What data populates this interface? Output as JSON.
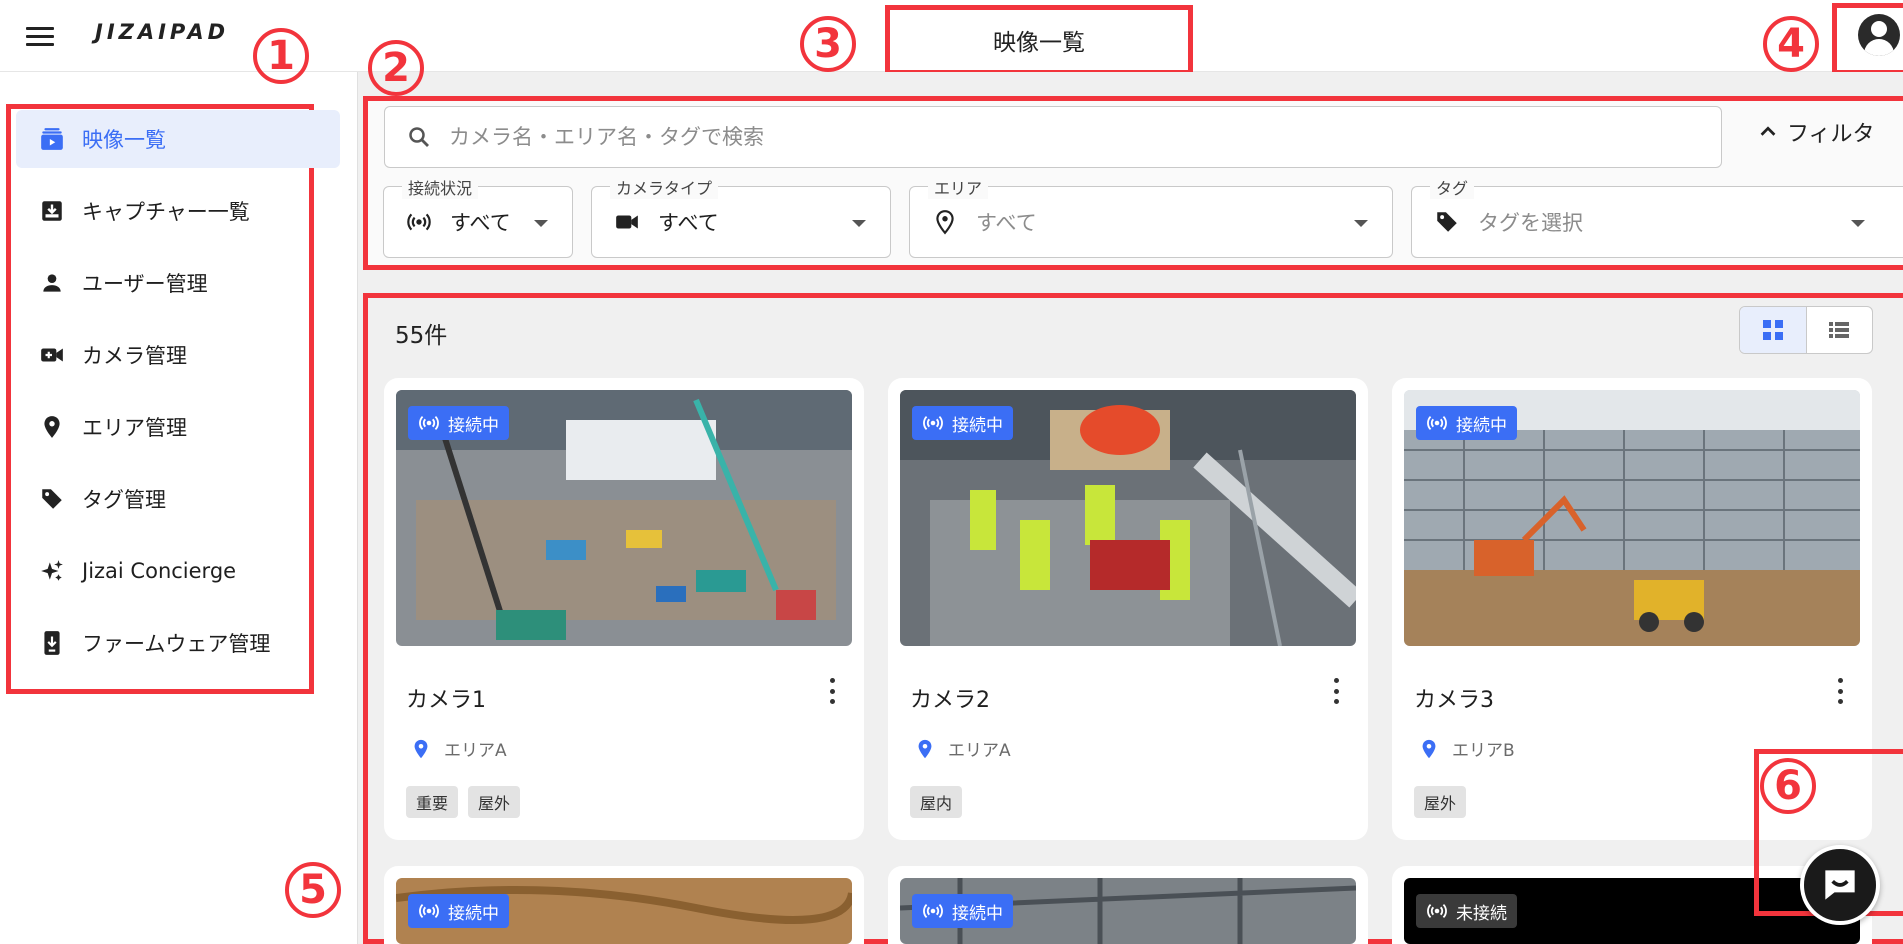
{
  "app": {
    "logo": "JIZAIPAD",
    "page_title": "映像一覧"
  },
  "annotations": [
    "1",
    "2",
    "3",
    "4",
    "5",
    "6"
  ],
  "sidebar": {
    "items": [
      {
        "label": "映像一覧",
        "icon": "video-list-icon",
        "active": true
      },
      {
        "label": "キャプチャー一覧",
        "icon": "capture-icon"
      },
      {
        "label": "ユーザー管理",
        "icon": "person-icon"
      },
      {
        "label": "カメラ管理",
        "icon": "video-camera-icon"
      },
      {
        "label": "エリア管理",
        "icon": "location-pin-icon"
      },
      {
        "label": "タグ管理",
        "icon": "tag-icon"
      },
      {
        "label": "Jizai Concierge",
        "icon": "sparkle-icon"
      },
      {
        "label": "ファームウェア管理",
        "icon": "firmware-icon"
      }
    ]
  },
  "search": {
    "placeholder": "カメラ名・エリア名・タグで検索",
    "filter_toggle": "フィルタ"
  },
  "filters": {
    "connection": {
      "label": "接続状況",
      "value": "すべて"
    },
    "camera_type": {
      "label": "カメラタイプ",
      "value": "すべて"
    },
    "area": {
      "label": "エリア",
      "value": "すべて"
    },
    "tag": {
      "label": "タグ",
      "value": "タグを選択"
    }
  },
  "results": {
    "count": "55件"
  },
  "cards": [
    {
      "name": "カメラ1",
      "status": "接続中",
      "area": "エリアA",
      "tags": [
        "重要",
        "屋外"
      ]
    },
    {
      "name": "カメラ2",
      "status": "接続中",
      "area": "エリアA",
      "tags": [
        "屋内"
      ]
    },
    {
      "name": "カメラ3",
      "status": "接続中",
      "area": "エリアB",
      "tags": [
        "屋外"
      ]
    },
    {
      "status": "接続中"
    },
    {
      "status": "接続中"
    },
    {
      "status": "未接続"
    }
  ],
  "colors": {
    "accent": "#3b6ef5",
    "annotation": "#f2343c",
    "disconnected": "#3a3a3a"
  }
}
